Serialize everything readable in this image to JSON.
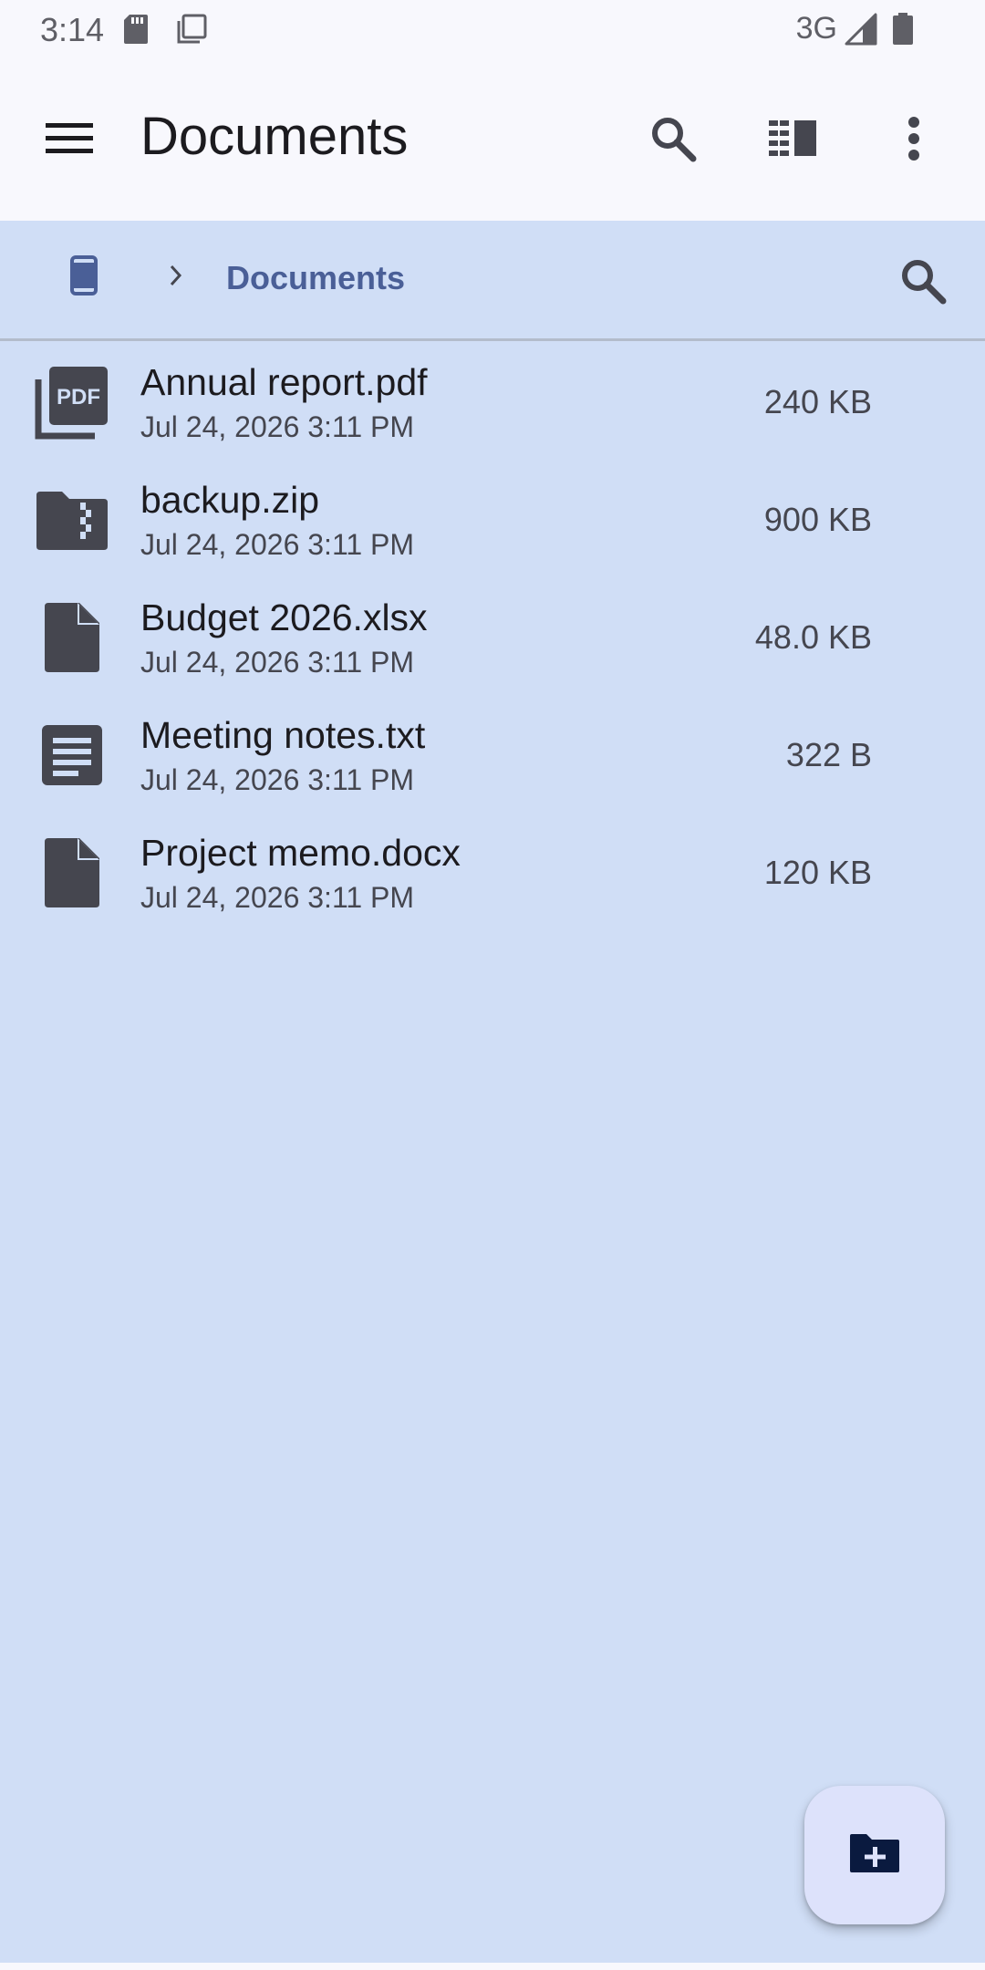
{
  "status_bar": {
    "time": "3:14",
    "network": "3G",
    "icons": [
      "sd-card-icon",
      "copy-icon",
      "signal-icon",
      "battery-icon"
    ]
  },
  "app_bar": {
    "title": "Documents",
    "icons": [
      "menu-icon",
      "search-icon",
      "view-toggle-icon",
      "more-vert-icon"
    ]
  },
  "breadcrumb": {
    "device_icon": "phone-icon",
    "separator_icon": "chevron-right-icon",
    "current": "Documents",
    "search_icon": "search-icon"
  },
  "files": [
    {
      "name": "Annual report.pdf",
      "date": "Jul 24, 2026 3:11 PM",
      "size": "240 KB",
      "icon": "pdf-icon"
    },
    {
      "name": "backup.zip",
      "date": "Jul 24, 2026 3:11 PM",
      "size": "900 KB",
      "icon": "zip-folder-icon"
    },
    {
      "name": "Budget 2026.xlsx",
      "date": "Jul 24, 2026 3:11 PM",
      "size": "48.0 KB",
      "icon": "file-icon"
    },
    {
      "name": "Meeting notes.txt",
      "date": "Jul 24, 2026 3:11 PM",
      "size": "322 B",
      "icon": "text-file-icon"
    },
    {
      "name": "Project memo.docx",
      "date": "Jul 24, 2026 3:11 PM",
      "size": "120 KB",
      "icon": "file-icon"
    }
  ],
  "fab": {
    "icon": "new-folder-icon"
  },
  "colors": {
    "background": "#d0def6",
    "app_bar": "#f8f8fd",
    "accent": "#4a5f97",
    "icon": "#45464f",
    "fab": "#dde2fb"
  }
}
